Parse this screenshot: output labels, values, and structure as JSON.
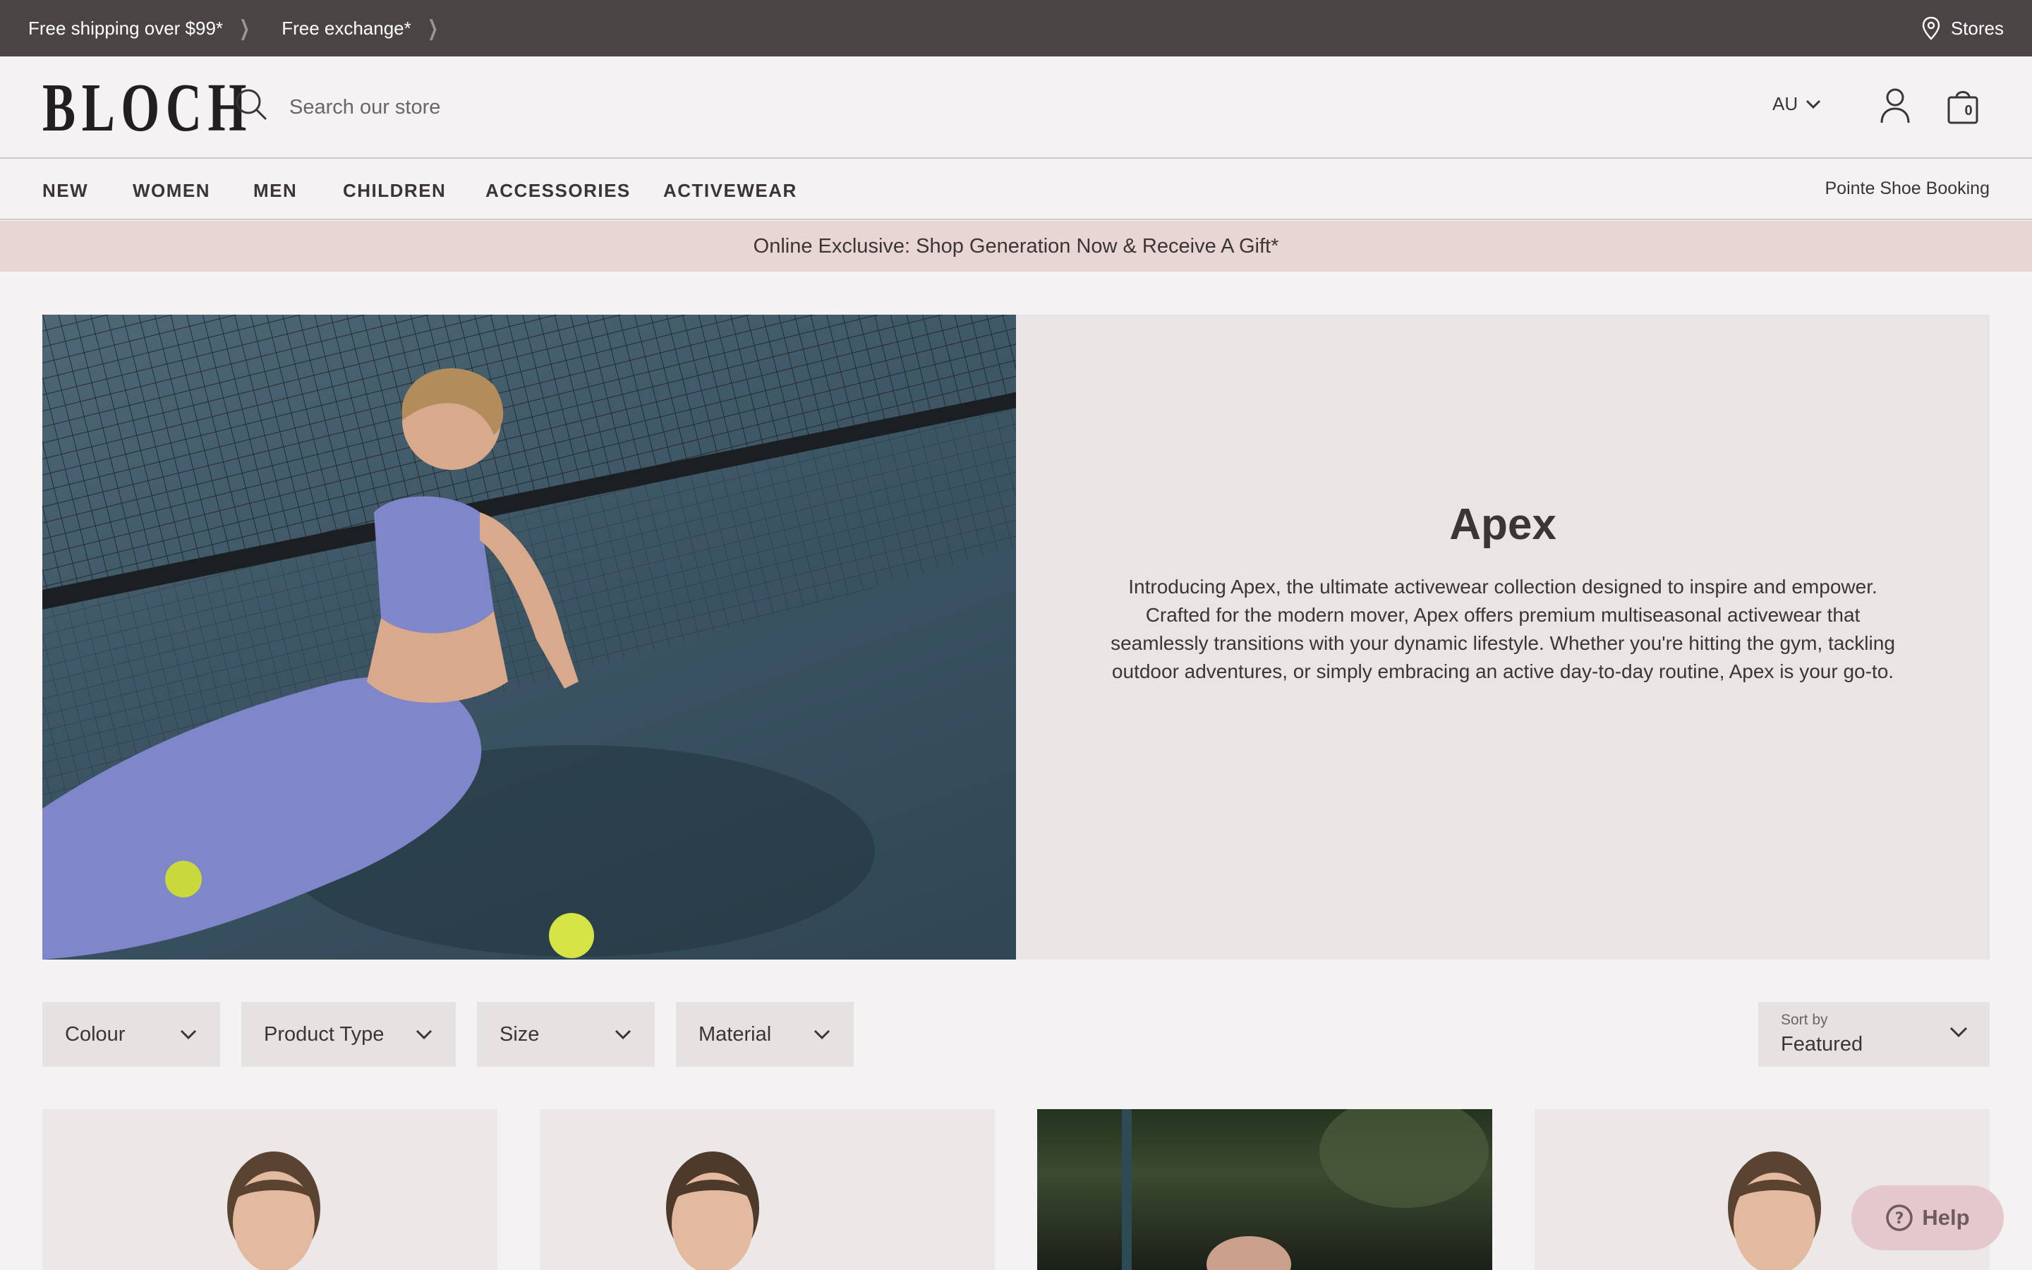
{
  "topbar": {
    "promo_shipping": "Free shipping over $99*",
    "promo_exchange": "Free exchange*",
    "stores": "Stores"
  },
  "header": {
    "logo": "BLOCH",
    "search_placeholder": "Search our store",
    "region": "AU",
    "cart_count": "0"
  },
  "nav": {
    "items": [
      "NEW",
      "WOMEN",
      "MEN",
      "CHILDREN",
      "ACCESSORIES",
      "ACTIVEWEAR"
    ],
    "booking": "Pointe Shoe Booking"
  },
  "announcement": "Online Exclusive: Shop Generation Now & Receive A Gift*",
  "hero": {
    "title": "Apex",
    "description": "Introducing Apex, the ultimate activewear collection designed to inspire and empower. Crafted for the modern mover, Apex offers premium multiseasonal activewear that seamlessly transitions with your dynamic lifestyle. Whether you're hitting the gym, tackling outdoor adventures, or simply embracing an active day-to-day routine, Apex is your go-to."
  },
  "filters": [
    "Colour",
    "Product Type",
    "Size",
    "Material"
  ],
  "sort": {
    "label": "Sort by",
    "value": "Featured"
  },
  "help": "Help",
  "colors": {
    "topbar": "#4a4445",
    "announcement": "#e8d6d4",
    "hero_panel": "#e8e5e4",
    "help_button": "#e5c8cb"
  },
  "icons": [
    "chevron-right-icon",
    "location-pin-icon",
    "search-icon",
    "chevron-down-icon",
    "account-icon",
    "shopping-bag-icon",
    "help-circle-icon"
  ]
}
